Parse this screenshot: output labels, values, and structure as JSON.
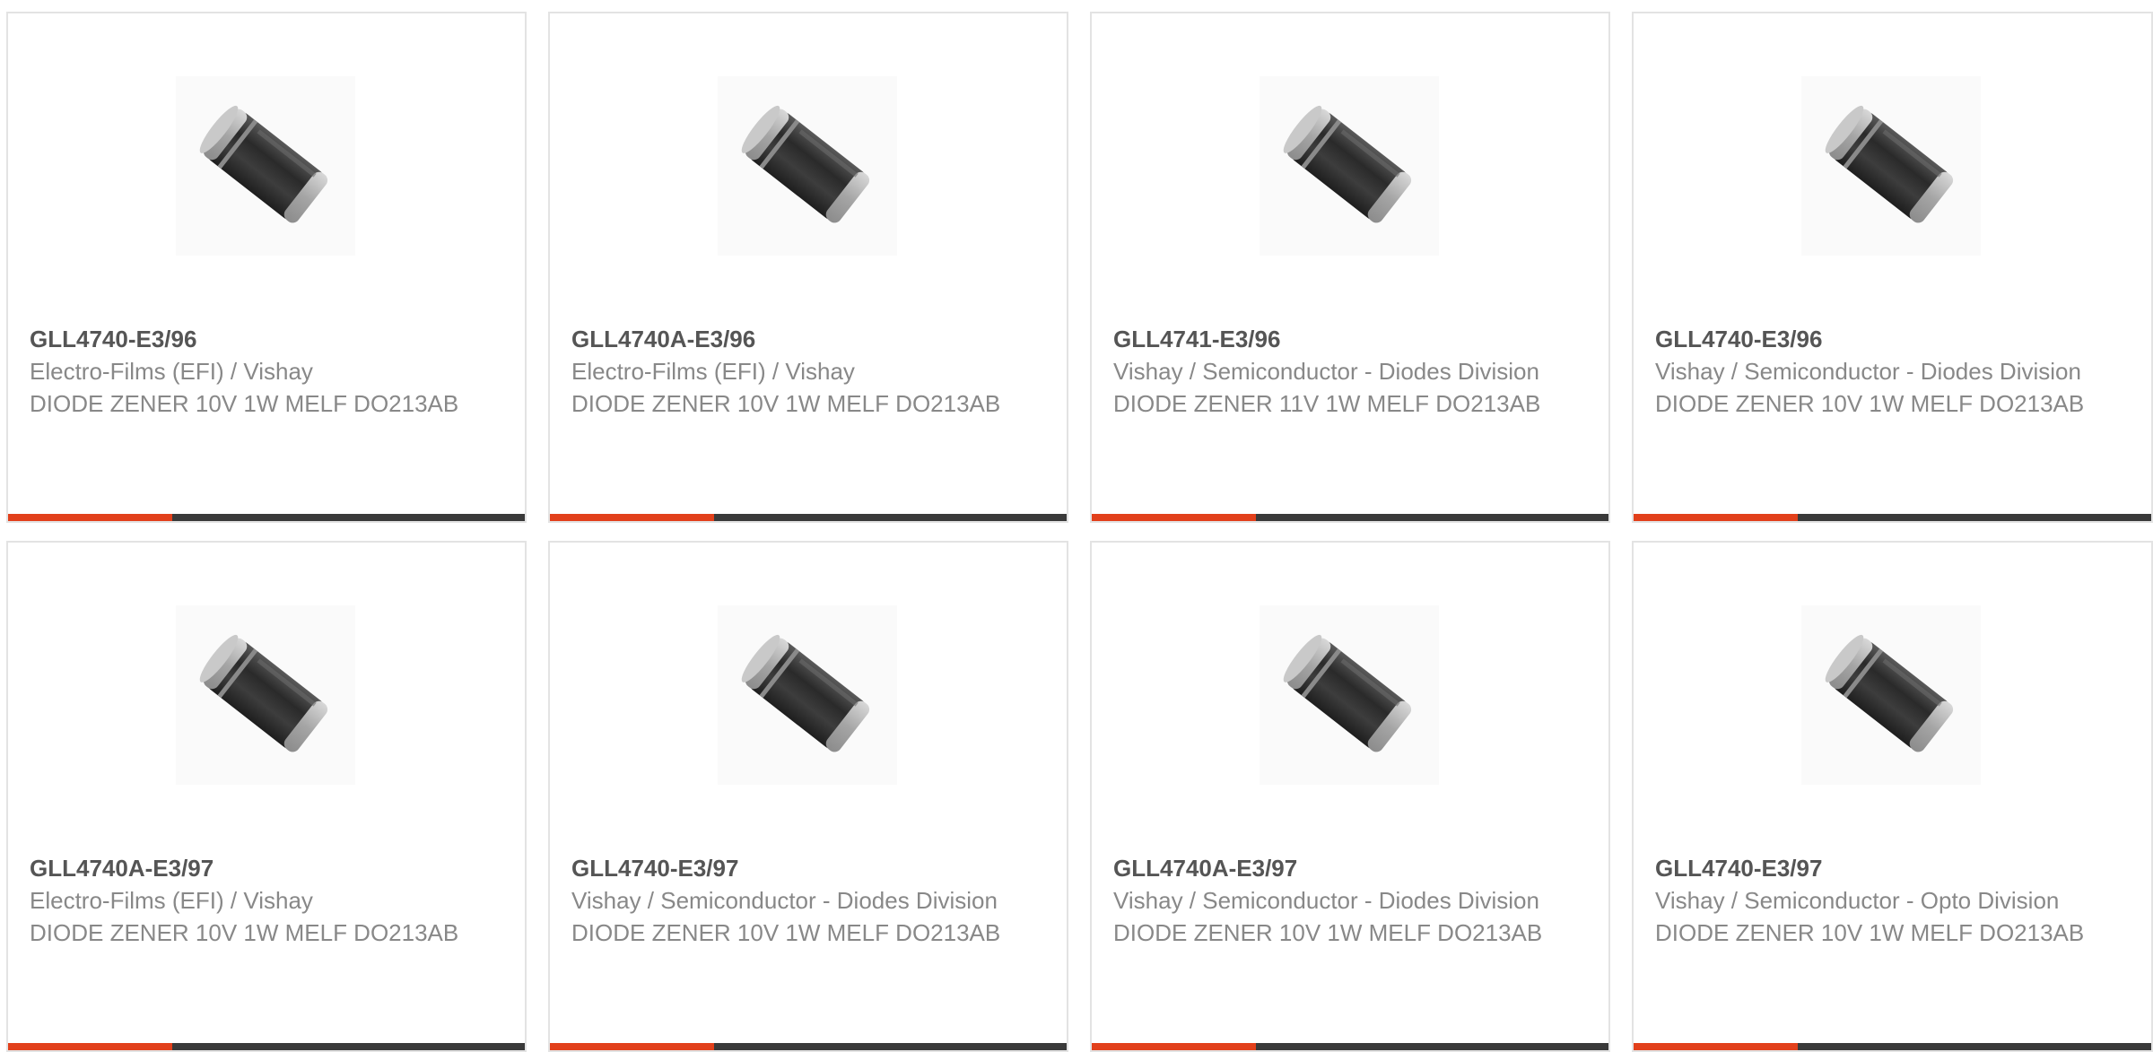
{
  "colors": {
    "accent": "#e2401b",
    "bar_dark": "#3a3a3a",
    "text_gray": "#888888",
    "title_gray": "#555555"
  },
  "products": [
    {
      "part_number": "GLL4740-E3/96",
      "manufacturer": "Electro-Films (EFI) / Vishay",
      "description": "DIODE ZENER 10V 1W MELF DO213AB",
      "image_icon": "melf-diode-icon"
    },
    {
      "part_number": "GLL4740A-E3/96",
      "manufacturer": "Electro-Films (EFI) / Vishay",
      "description": "DIODE ZENER 10V 1W MELF DO213AB",
      "image_icon": "melf-diode-icon"
    },
    {
      "part_number": "GLL4741-E3/96",
      "manufacturer": "Vishay / Semiconductor - Diodes Division",
      "description": "DIODE ZENER 11V 1W MELF DO213AB",
      "image_icon": "melf-diode-icon"
    },
    {
      "part_number": "GLL4740-E3/96",
      "manufacturer": "Vishay / Semiconductor - Diodes Division",
      "description": "DIODE ZENER 10V 1W MELF DO213AB",
      "image_icon": "melf-diode-icon"
    },
    {
      "part_number": "GLL4740A-E3/97",
      "manufacturer": "Electro-Films (EFI) / Vishay",
      "description": "DIODE ZENER 10V 1W MELF DO213AB",
      "image_icon": "melf-diode-icon"
    },
    {
      "part_number": "GLL4740-E3/97",
      "manufacturer": "Vishay / Semiconductor - Diodes Division",
      "description": "DIODE ZENER 10V 1W MELF DO213AB",
      "image_icon": "melf-diode-icon"
    },
    {
      "part_number": "GLL4740A-E3/97",
      "manufacturer": "Vishay / Semiconductor - Diodes Division",
      "description": "DIODE ZENER 10V 1W MELF DO213AB",
      "image_icon": "melf-diode-icon"
    },
    {
      "part_number": "GLL4740-E3/97",
      "manufacturer": "Vishay / Semiconductor - Opto Division",
      "description": "DIODE ZENER 10V 1W MELF DO213AB",
      "image_icon": "melf-diode-icon"
    }
  ]
}
